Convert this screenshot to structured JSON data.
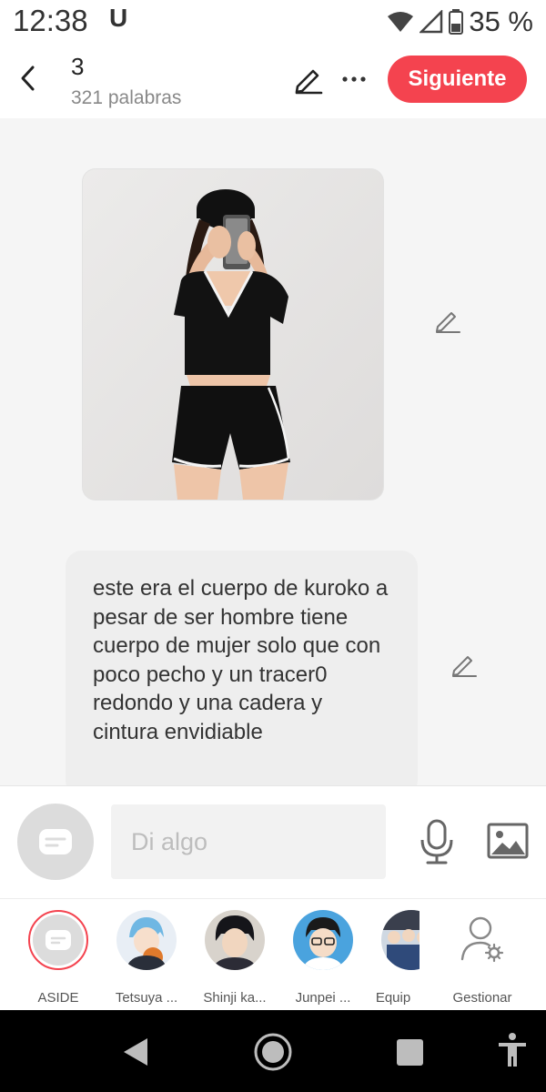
{
  "status_bar": {
    "time": "12:38",
    "carrier_icon_text": "U",
    "battery": "35 %"
  },
  "header": {
    "title": "3",
    "word_count": "321 palabras",
    "next_button": "Siguiente"
  },
  "content": {
    "message_text": "este era el cuerpo de kuroko a pesar de ser hombre tiene cuerpo de mujer solo que con poco pecho y un tracer0 redondo y una cadera y cintura envidiable"
  },
  "input": {
    "placeholder": "Di algo"
  },
  "characters": [
    {
      "label": "ASIDE"
    },
    {
      "label": "Tetsuya ..."
    },
    {
      "label": "Shinji ka..."
    },
    {
      "label": "Junpei ..."
    },
    {
      "label": "Equip"
    },
    {
      "label": "Gestionar"
    }
  ],
  "colors": {
    "accent": "#f4434f",
    "background": "#f5f5f5",
    "bubble": "#eeeeee"
  }
}
